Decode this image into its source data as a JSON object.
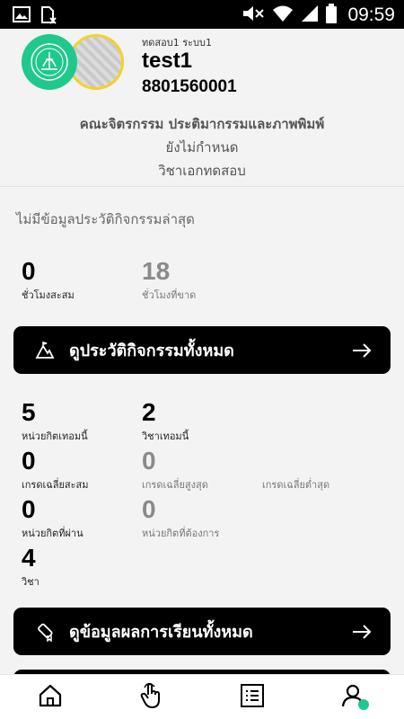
{
  "status_bar": {
    "time": "09:59",
    "icons": [
      "image-icon",
      "sim-blocked-icon",
      "mute-icon",
      "wifi-icon",
      "signal-icon",
      "battery-icon"
    ]
  },
  "profile": {
    "subtitle": "ทดสอบ1 ระบบ1",
    "name": "test1",
    "student_id": "8801560001",
    "faculty": "คณะจิตรกรรม ประติมากรรมและภาพพิมพ์",
    "line2": "ยังไม่กำหนด",
    "line3": "วิชาเอกทดสอบ",
    "logo_color": "#1fc98e",
    "photo_ring_color": "#f2d22b"
  },
  "activity": {
    "empty_message": "ไม่มีข้อมูลประวัติกิจกรรมล่าสุด",
    "accumulated_hours": {
      "value": "0",
      "label": "ชั่วโมงสะสม"
    },
    "missing_hours": {
      "value": "18",
      "label": "ชั่วโมงที่ขาด"
    },
    "button_label": "ดูประวัติกิจกรรมทั้งหมด"
  },
  "academic": {
    "credits_this_term": {
      "value": "5",
      "label": "หน่วยกิตเทอมนี้"
    },
    "courses_this_term": {
      "value": "2",
      "label": "วิชาเทอมนี้"
    },
    "gpa_cumulative": {
      "value": "0",
      "label": "เกรดเฉลี่ยสะสม"
    },
    "gpa_highest": {
      "value": "0",
      "label": "เกรดเฉลี่ยสูงสุด"
    },
    "gpa_lowest": {
      "value": "",
      "label": "เกรดเฉลี่ยต่ำสุด"
    },
    "credits_passed": {
      "value": "0",
      "label": "หน่วยกิตที่ผ่าน"
    },
    "credits_required": {
      "value": "0",
      "label": "หน่วยกิตที่ต้องการ"
    },
    "courses": {
      "value": "4",
      "label": "วิชา"
    },
    "button_label": "ดูข้อมูลผลการเรียนทั้งหมด"
  },
  "bottom_nav": {
    "items": [
      "home-icon",
      "activity-touch-icon",
      "list-icon",
      "profile-icon"
    ],
    "active": "profile-icon",
    "accent": "#1fc98e"
  }
}
